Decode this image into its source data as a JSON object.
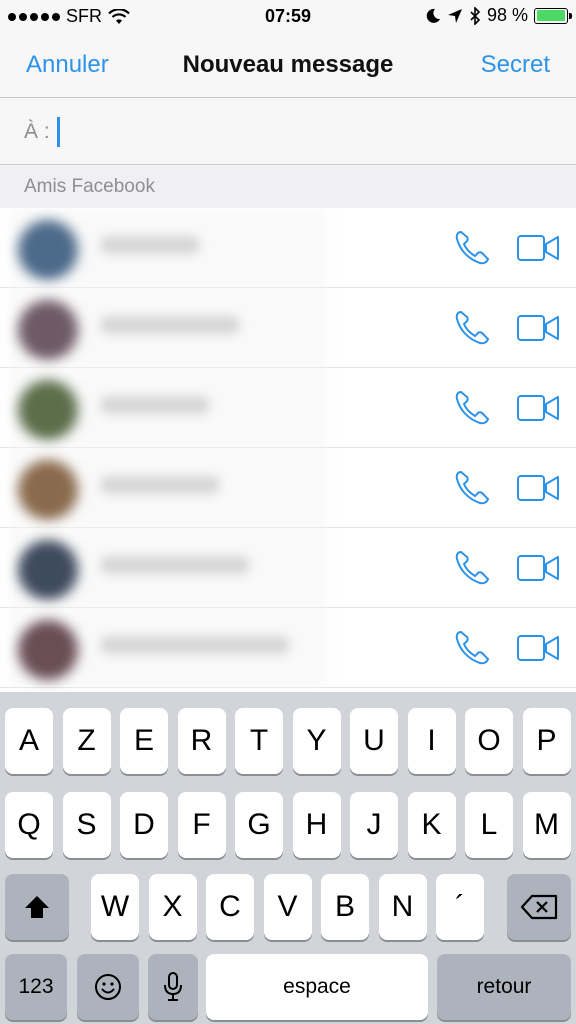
{
  "status_bar": {
    "carrier": "SFR",
    "time": "07:59",
    "battery_percent": "98 %",
    "battery_level": 0.98
  },
  "nav": {
    "cancel_label": "Annuler",
    "title": "Nouveau message",
    "secret_label": "Secret"
  },
  "to_field": {
    "label": "À :"
  },
  "section": {
    "header": "Amis Facebook"
  },
  "contacts": [
    {
      "avatar_color": "#4c6a8a",
      "call_icon": "phone-icon",
      "video_icon": "video-camera-icon"
    },
    {
      "avatar_color": "#6e5a66",
      "call_icon": "phone-icon",
      "video_icon": "video-camera-icon"
    },
    {
      "avatar_color": "#5c6e4a",
      "call_icon": "phone-icon",
      "video_icon": "video-camera-icon"
    },
    {
      "avatar_color": "#8a6a4c",
      "call_icon": "phone-icon",
      "video_icon": "video-camera-icon"
    },
    {
      "avatar_color": "#3e4a5e",
      "call_icon": "phone-icon",
      "video_icon": "video-camera-icon"
    },
    {
      "avatar_color": "#6a4e56",
      "call_icon": "phone-icon",
      "video_icon": "video-camera-icon"
    }
  ],
  "keyboard": {
    "row1": [
      "A",
      "Z",
      "E",
      "R",
      "T",
      "Y",
      "U",
      "I",
      "O",
      "P"
    ],
    "row2": [
      "Q",
      "S",
      "D",
      "F",
      "G",
      "H",
      "J",
      "K",
      "L",
      "M"
    ],
    "row3": [
      "W",
      "X",
      "C",
      "V",
      "B",
      "N",
      "´"
    ],
    "numbers_label": "123",
    "space_label": "espace",
    "return_label": "retour"
  },
  "colors": {
    "accent": "#2d93e8",
    "battery": "#4cd964"
  }
}
